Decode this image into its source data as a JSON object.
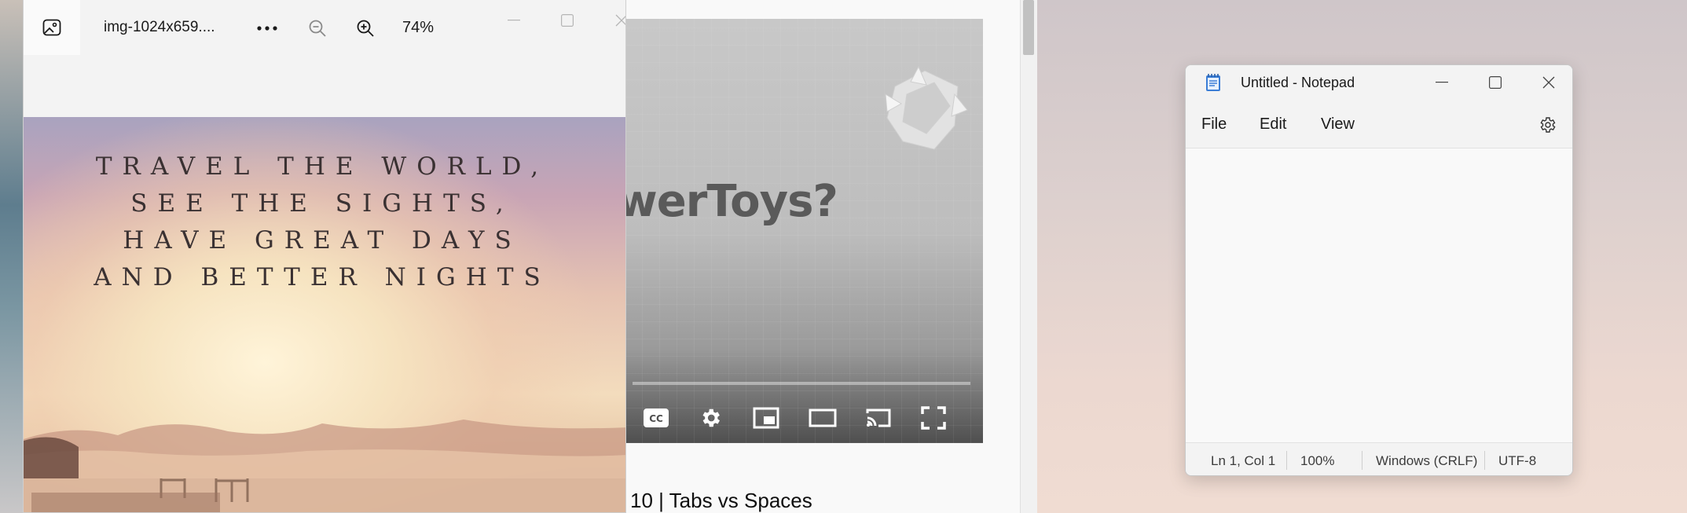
{
  "photos": {
    "filename": "img-1024x659....",
    "zoom": "74%",
    "image_text": [
      "Travel the world,",
      "see the sights,",
      "have great days",
      "and better nights"
    ]
  },
  "browser": {
    "video_title": "werToys?",
    "video_caption": "10 | Tabs vs Spaces"
  },
  "notepad": {
    "title": "Untitled - Notepad",
    "menu": [
      "File",
      "Edit",
      "View"
    ],
    "status": {
      "position": "Ln 1, Col 1",
      "zoom": "100%",
      "line_ending": "Windows (CRLF)",
      "encoding": "UTF-8"
    },
    "content": ""
  }
}
